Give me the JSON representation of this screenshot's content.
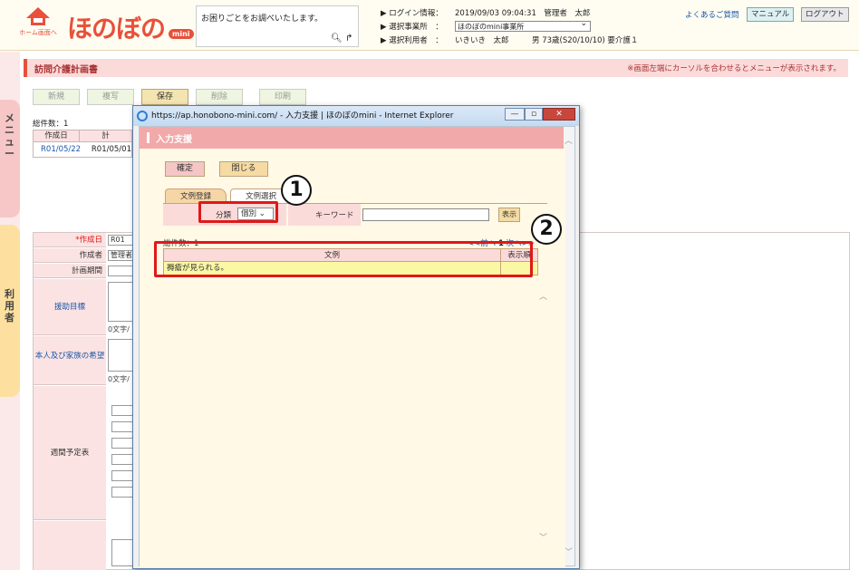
{
  "header": {
    "home_label": "ホーム画面へ",
    "logo_text": "ほのぼの",
    "logo_badge": "mini",
    "search_placeholder": "お困りごとをお調べいたします。",
    "login_info_label": "ログイン情報：",
    "login_info_value": "2019/09/03 09:04:31　管理者　太郎",
    "office_label": "選択事業所　：",
    "office_value": "ほのぼのmini事業所",
    "user_label": "選択利用者　：",
    "user_value": "いきいき　太郎　　　男 73歳(S20/10/10) 要介護１",
    "faq_link": "よくあるご質問",
    "manual_button": "マニュアル",
    "logout_button": "ログアウト"
  },
  "sidebar": {
    "menu_label": "メニュー",
    "user_label": "利用者"
  },
  "page": {
    "title": "訪問介護計画書",
    "note": "※画面左端にカーソルを合わせるとメニューが表示されます。",
    "toolbar": [
      "新規",
      "複写",
      "保存",
      "削除",
      "印刷"
    ],
    "total_count": "総件数：1",
    "list_headers": [
      "作成日",
      "計"
    ],
    "list_row": [
      "R01/05/22",
      "R01/05/01"
    ],
    "form_labels": {
      "created_date": "*作成日",
      "creator": "作成者",
      "plan_period": "計画期間",
      "support_goal": "援助目標",
      "wishes": "本人及び家族の希望",
      "weekly_plan": "週間予定表"
    },
    "form_values": {
      "created_date": "R01",
      "creator": "管理者"
    },
    "char_count": "0文字/"
  },
  "dialog": {
    "window_title": "https://ap.honobono-mini.com/ - 入力支援 | ほのぼのmini - Internet Explorer",
    "header": "入力支援",
    "confirm_button": "確定",
    "close_button": "閉じる",
    "tab_register": "文例登録",
    "tab_select": "文例選択",
    "category_label": "分類",
    "category_value": "個別",
    "keyword_label": "キーワード",
    "keyword_value": "",
    "show_button": "表示",
    "total_count": "総件数：1",
    "pager_prev": "<<前へ",
    "pager_page": "1",
    "pager_next": "次へ>>",
    "table_headers": [
      "文例",
      "表示順"
    ],
    "table_rows": [
      [
        "褥瘡が見られる。",
        ""
      ]
    ]
  },
  "annotations": {
    "badge_1": "1",
    "badge_2": "2"
  },
  "colors": {
    "accent": "#e8503a",
    "highlight": "#e01818",
    "row_highlight": "#fbf8a4"
  }
}
